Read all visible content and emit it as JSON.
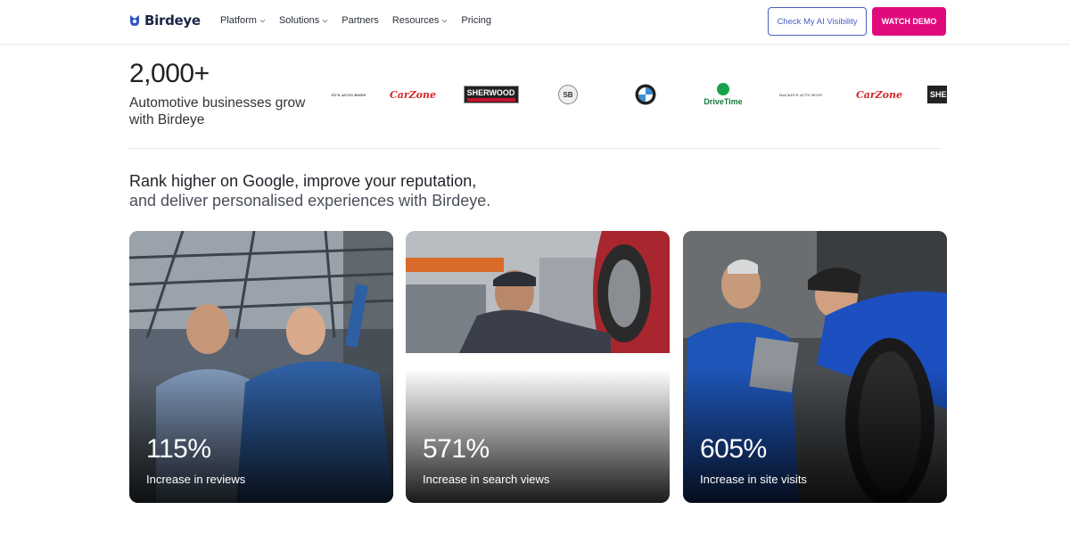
{
  "brand": {
    "name": "Birdeye",
    "color": "#1c2545"
  },
  "nav": {
    "items": [
      {
        "label": "Platform",
        "dropdown": true
      },
      {
        "label": "Solutions",
        "dropdown": true
      },
      {
        "label": "Partners",
        "dropdown": false
      },
      {
        "label": "Resources",
        "dropdown": true
      },
      {
        "label": "Pricing",
        "dropdown": false
      }
    ]
  },
  "header": {
    "ai_visibility_label": "Check My AI Visibility",
    "demo_label": "WATCH DEMO",
    "accent": "#e10a7d",
    "outline_color": "#4a5fc1"
  },
  "stats": {
    "count": "2,000+",
    "subtitle": "Automotive businesses grow with Birdeye"
  },
  "logos": {
    "items": [
      {
        "name": "auto-dealer-logo",
        "text": "ZT'S AUTO BODY"
      },
      {
        "name": "carzone-logo",
        "text": "CarZone"
      },
      {
        "name": "sherwood-gmc-logo",
        "text": "SHERWOOD"
      },
      {
        "name": "sb-logo",
        "text": "SB"
      },
      {
        "name": "bmw-logo",
        "text": ""
      },
      {
        "name": "drivetime-logo",
        "text": "DriveTime"
      },
      {
        "name": "mackin-auto-logo",
        "text": "MACKIN'S AUTO BODY"
      },
      {
        "name": "carzone-logo-2",
        "text": "CarZone"
      },
      {
        "name": "sherwood-logo-2",
        "text": "SHE"
      }
    ]
  },
  "headline": {
    "line1": "Rank higher on Google, improve your reputation,",
    "line2": "and deliver personalised experiences with Birdeye."
  },
  "cards": [
    {
      "value": "115%",
      "label": "Increase in reviews"
    },
    {
      "value": "571%",
      "label": "Increase in search views"
    },
    {
      "value": "605%",
      "label": "Increase in site visits"
    }
  ]
}
